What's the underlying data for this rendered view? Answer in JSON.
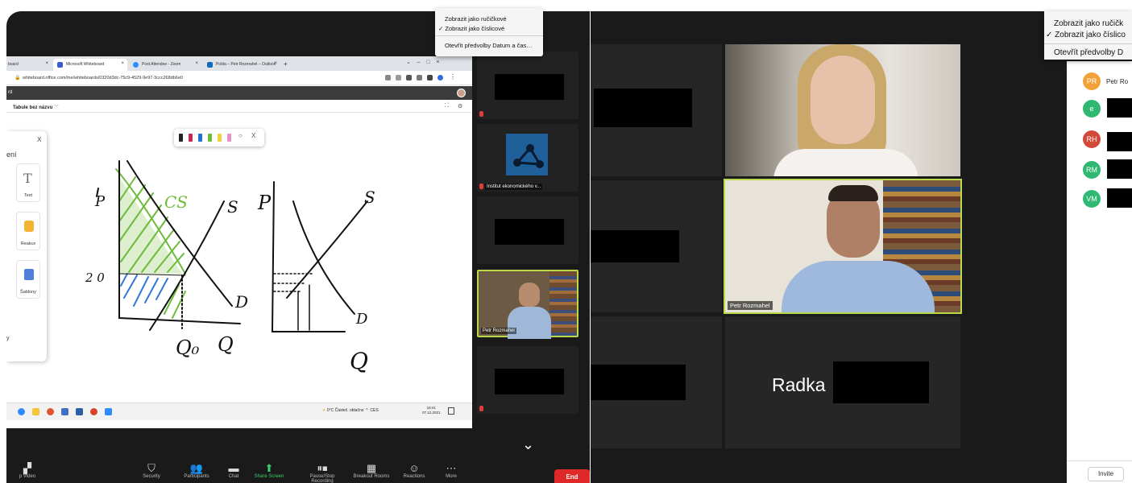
{
  "left_window": {
    "browser": {
      "tabs": [
        {
          "label": "board",
          "active": false
        },
        {
          "label": "Microsoft Whiteboard",
          "active": true
        },
        {
          "label": "Post Attendee - Zoom",
          "active": false
        },
        {
          "label": "Pošta – Petr Rozmahel – Outlook",
          "active": false
        }
      ],
      "new_tab": "+",
      "url": "whiteboard.office.com/me/whiteboards/0320d3dc-75c9-4529-9e97-3ccc268db6e0",
      "app_name": "rd"
    },
    "whiteboard": {
      "board_title": "Tabule bez názvu ",
      "board_title_chevron": "﹀",
      "panel_heading": "ení",
      "panel_close": "X",
      "panel_items": [
        {
          "label": "Text",
          "icon": "text-icon"
        },
        {
          "label": "Reakce",
          "icon": "thumbs-up-icon"
        },
        {
          "label": "Šablony",
          "icon": "templates-icon"
        }
      ],
      "panel_tail": "y",
      "pen_toolbar_close": "X"
    },
    "taskbar": {
      "weather": "0°C Částeč. oblačno",
      "lang": "CES",
      "time": "18:41",
      "date": "07.12.2021"
    },
    "context_menu": {
      "items": [
        "Zobrazit jako ručičkové",
        "✓ Zobrazit jako číslicové",
        "Otevřít předvolby Datum a čas…"
      ]
    },
    "gallery": {
      "tiles": [
        {
          "name": ""
        },
        {
          "name": "Institut ekonomického v..."
        },
        {
          "name": ""
        },
        {
          "name": "Petr Rozmahel"
        },
        {
          "name": ""
        }
      ]
    },
    "zoom_toolbar": {
      "buttons": [
        {
          "label": "p Video",
          "icon": "video-off-icon"
        },
        {
          "label": "Security",
          "icon": "shield-icon"
        },
        {
          "label": "Participants",
          "icon": "participants-icon",
          "count": "2"
        },
        {
          "label": "Chat",
          "icon": "chat-icon"
        },
        {
          "label": "Share Screen",
          "icon": "share-icon"
        },
        {
          "label": "Pause/Stop Recording",
          "icon": "pause-icon"
        },
        {
          "label": "Breakout Rooms",
          "icon": "rooms-icon"
        },
        {
          "label": "Reactions",
          "icon": "reactions-icon"
        },
        {
          "label": "More",
          "icon": "more-icon"
        }
      ],
      "end_label": "End"
    }
  },
  "right_window": {
    "speaker_name": "Petr Rozmahel",
    "text_tile_name": "Radka",
    "participants": [
      {
        "initials": "PR",
        "name": "Petr Ro",
        "color": "#f2a23a"
      },
      {
        "initials": "e",
        "name": "",
        "color": "#2eb872"
      },
      {
        "initials": "RH",
        "name": "",
        "color": "#d2493a"
      },
      {
        "initials": "RM",
        "name": "",
        "color": "#2eb872"
      },
      {
        "initials": "VM",
        "name": "",
        "color": "#2eb872"
      }
    ],
    "invite_label": "Invite",
    "context_menu": {
      "items": [
        "Zobrazit jako ručičk",
        "✓ Zobrazit jako číslico",
        "Otevřít předvolby D"
      ]
    }
  },
  "sketch_labels": {
    "p1": "P",
    "cs": "CS",
    "s1": "S",
    "twenty": "2 0",
    "d1": "D",
    "q0": "Q₀",
    "q1": "Q",
    "p2": "P",
    "s2": "S",
    "d2": "D",
    "q2": "Q"
  }
}
